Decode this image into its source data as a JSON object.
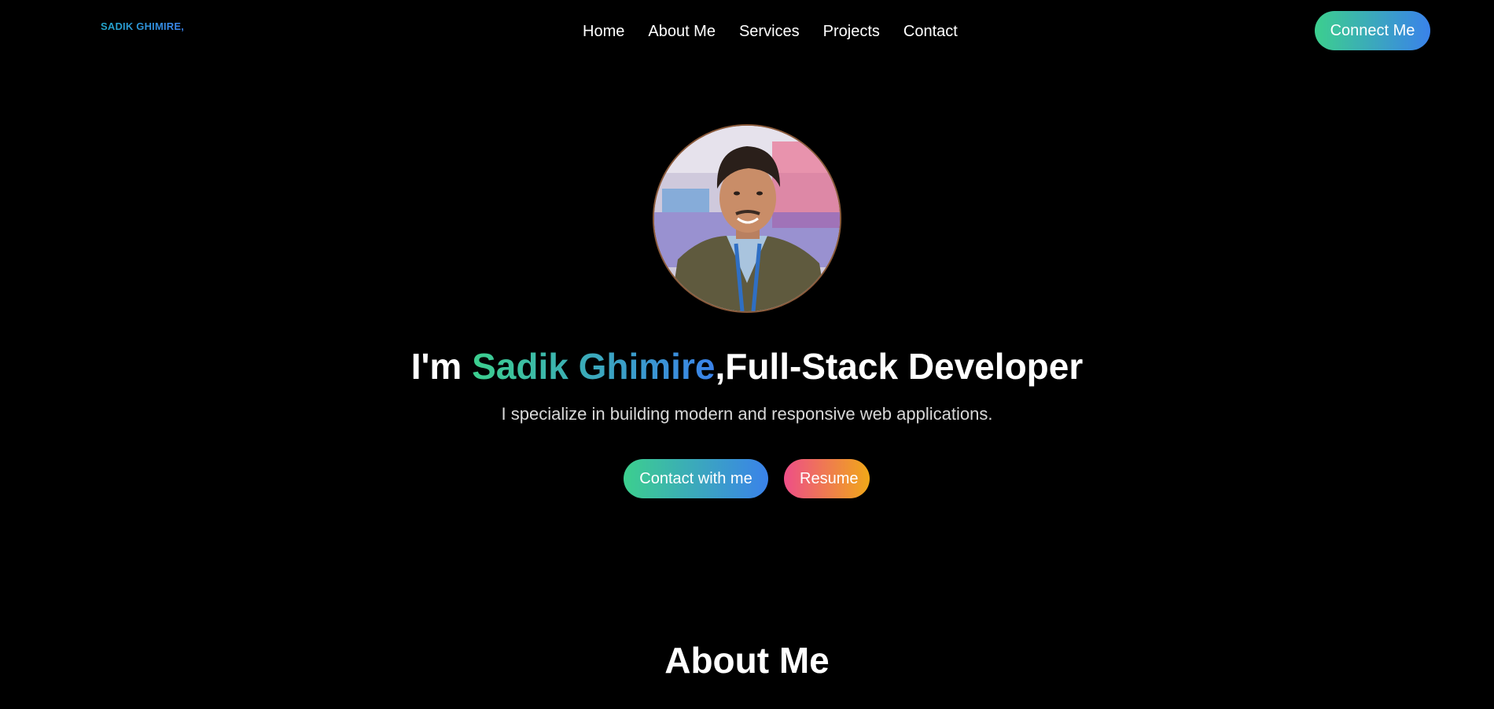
{
  "navbar": {
    "logo": "SADIK GHIMIRE,",
    "links": [
      "Home",
      "About Me",
      "Services",
      "Projects",
      "Contact"
    ],
    "cta_label": "Connect Me"
  },
  "hero": {
    "headline_prefix": "I'm ",
    "headline_name": "Sadik Ghimire",
    "headline_suffix": ",Full-Stack Developer",
    "subtitle": "I specialize in building modern and responsive web applications.",
    "contact_button": "Contact with me",
    "resume_button": "Resume"
  },
  "about": {
    "title": "About Me"
  },
  "colors": {
    "background": "#000000",
    "gradient_green": "#3ccf8e",
    "gradient_blue": "#3a82ea",
    "gradient_pink": "#ee4e88",
    "gradient_orange": "#f0a818"
  }
}
